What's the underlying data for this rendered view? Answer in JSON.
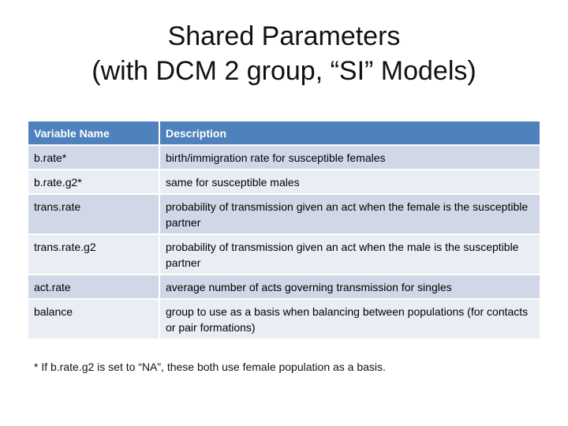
{
  "slide": {
    "title_line1": "Shared Parameters",
    "title_line2": "(with DCM 2 group, “SI” Models)"
  },
  "table": {
    "headers": [
      "Variable Name",
      "Description"
    ],
    "rows": [
      {
        "name": "b.rate*",
        "description": "birth/immigration rate for susceptible females"
      },
      {
        "name": "b.rate.g2*",
        "description": "same for susceptible males"
      },
      {
        "name": "trans.rate",
        "description": "probability of transmission given an act when the female is the susceptible partner"
      },
      {
        "name": "trans.rate.g2",
        "description": "probability of transmission given an act when the male is the susceptible partner"
      },
      {
        "name": "act.rate",
        "description": "average number of acts governing transmission for singles"
      },
      {
        "name": "balance",
        "description": "group to use as a basis when balancing between populations (for contacts or pair formations)"
      }
    ]
  },
  "footnote": "* If b.rate.g2 is set to “NA”, these both use female population as a basis.",
  "colors": {
    "header_bg": "#4f81bd",
    "row_odd_bg": "#d0d8e8",
    "row_even_bg": "#e9edf4",
    "header_text": "#ffffff",
    "body_text": "#000000"
  }
}
